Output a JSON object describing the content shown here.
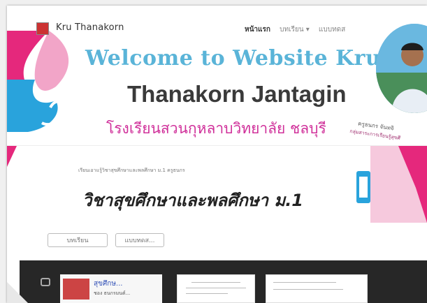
{
  "header": {
    "site_title": "Kru Thanakorn",
    "nav": [
      "หน้าแรก",
      "บทเรียน ▾",
      "แบบทดส"
    ],
    "welcome": "Welcome to Website Kru Nut",
    "name": "Thanakorn Jantagin",
    "school": "โรงเรียนสวนกุหลาบวิทยาลัย ชลบุรี",
    "photo_caption": "ครูธนกร จันทจิ",
    "photo_caption2": "กลุ่มสาระการเรียนรู้สุขศึ"
  },
  "banner": {
    "subtitle": "เรียนเอาแรู้วิชาสุขศึกษาและพลศึกษา ม.1 ครูธนกร",
    "title": "วิชาสุขศึกษาและพลศึกษา ม.1"
  },
  "buttons": {
    "lessons": "บทเรียน",
    "tests": "แบบทดส..."
  },
  "strip": {
    "thumb1_title": "สุขศึกษ...",
    "thumb1_sub": "ชอง ธนกรมนต์..."
  },
  "colors": {
    "welcome": "#5ab4d8",
    "school": "#d0309a",
    "accent_pink": "#e5287c",
    "accent_blue": "#29a3dc"
  }
}
